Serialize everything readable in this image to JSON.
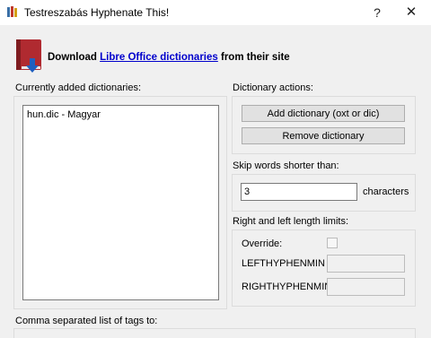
{
  "window": {
    "title": "Testreszabás Hyphenate This!",
    "help_glyph": "?",
    "close_glyph": "✕",
    "app_icon": "books-icon"
  },
  "download": {
    "prefix": "Download ",
    "link_text": "Libre Office dictionaries",
    "suffix": " from their site",
    "icon": "book-download-icon",
    "link_color": "#0000cc"
  },
  "dictionaries": {
    "label": "Currently added dictionaries:",
    "items": [
      "hun.dic - Magyar"
    ]
  },
  "actions": {
    "label": "Dictionary actions:",
    "add_label": "Add dictionary (oxt or dic)",
    "remove_label": "Remove dictionary"
  },
  "skip": {
    "label": "Skip words shorter than:",
    "value": "3",
    "unit": "characters"
  },
  "limits": {
    "label": "Right and left length limits:",
    "override_label": "Override:",
    "left_label": "LEFTHYPHENMIN",
    "right_label": "RIGHTHYPHENMIN",
    "override_checked": false
  },
  "tags": {
    "label": "Comma separated list of tags to:"
  }
}
